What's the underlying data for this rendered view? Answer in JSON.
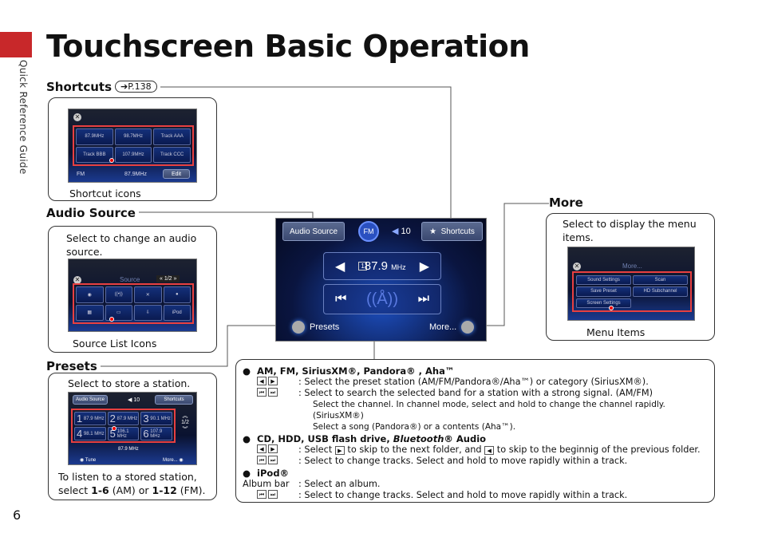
{
  "page": {
    "section": "Quick Reference Guide",
    "title": "Touchscreen Basic Operation",
    "page_number": "6",
    "accent": "#c8282a"
  },
  "shortcuts": {
    "heading": "Shortcuts",
    "ref": "P.138",
    "caption": "Shortcut icons",
    "tiles": [
      "87.9MHz",
      "98.7MHz",
      "Track AAA",
      "Track BBB",
      "107.9MHz",
      "Track CCC"
    ],
    "current_band": "FM",
    "current_freq": "87.9MHz",
    "edit": "Edit"
  },
  "audio_source": {
    "heading": "Audio Source",
    "desc": "Select to change an audio source.",
    "caption": "Source List Icons",
    "screen_title": "Source",
    "page": "1/2",
    "ipod_label": "iPod"
  },
  "presets": {
    "heading": "Presets",
    "desc": "Select to store a station.",
    "caption_1": "To listen to a stored station,",
    "caption_2": "select ",
    "range_am": "1-6",
    "am": " (AM) or ",
    "range_fm": "1-12",
    "fm": " (FM).",
    "audio_source_btn": "Audio Source",
    "shortcuts_btn": "Shortcuts",
    "volume": "10",
    "items": [
      {
        "n": "1",
        "f": "87.9 MHz"
      },
      {
        "n": "2",
        "f": "87.9 MHz"
      },
      {
        "n": "3",
        "f": "90.1 MHz"
      },
      {
        "n": "4",
        "f": "98.1 MHz"
      },
      {
        "n": "5",
        "f": "106.1 MHz"
      },
      {
        "n": "6",
        "f": "107.9 MHz"
      }
    ],
    "page": "1/2",
    "freq": "87.9 MHz",
    "tune": "Tune",
    "more": "More..."
  },
  "more": {
    "heading": "More",
    "desc": "Select to display the menu items.",
    "caption": "Menu Items",
    "screen_title": "More...",
    "items": [
      "Sound Settings",
      "Scan",
      "Save Preset",
      "HD Subchannel",
      "Screen Settings"
    ]
  },
  "main_screen": {
    "audio_source": "Audio Source",
    "volume": "10",
    "shortcuts": "Shortcuts",
    "preset_num": "1",
    "freq": "87.9",
    "unit": "MHz",
    "presets": "Presets",
    "more": "More..."
  },
  "description": {
    "s1_title": "AM, FM, SiriusXM®, Pandora® , Aha™",
    "s1_l1": ": Select the preset station (AM/FM/Pandora®/Aha™) or category (SiriusXM®).",
    "s1_l2": ": Select to search the selected band for a station with a strong signal. (AM/FM)",
    "s1_l3": "Select the channel. In channel mode, select and hold to change the channel rapidly. (SiriusXM®)",
    "s1_l4": "Select a song (Pandora®) or a contents (Aha™).",
    "s2_title": "CD, HDD, USB flash drive, ",
    "s2_title_em": "Bluetooth®",
    "s2_title_end": " Audio",
    "s2_l1a": ": Select ",
    "s2_l1b": " to skip to the next folder, and ",
    "s2_l1c": " to skip to the beginnig of the previous folder.",
    "s2_l2": ": Select to change tracks. Select and hold to move rapidly within a track.",
    "s3_title": "iPod®",
    "s3_album": "Album bar",
    "s3_l1": ": Select an album.",
    "s3_l2": ": Select to change tracks. Select and hold to move rapidly within a track."
  }
}
